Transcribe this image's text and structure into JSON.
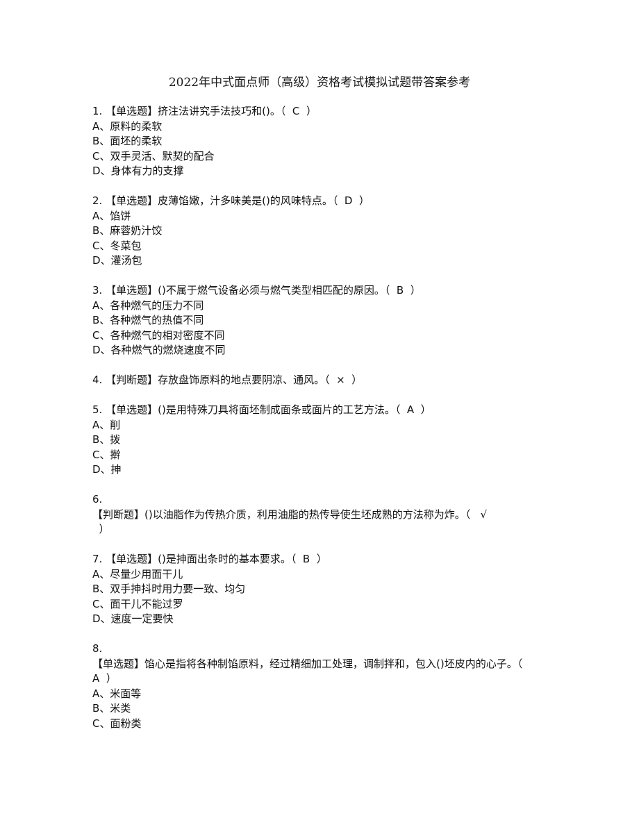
{
  "title": "2022年中式面点师（高级）资格考试模拟试题带答案参考",
  "questions": [
    {
      "number": "1.",
      "type": "【单选题】",
      "stem": "挤注法讲究手法技巧和()。",
      "answer": "C",
      "options": [
        "A、原料的柔软",
        "B、面坯的柔软",
        "C、双手灵活、默契的配合",
        "D、身体有力的支撑"
      ]
    },
    {
      "number": "2.",
      "type": "【单选题】",
      "stem": "皮薄馅嫩，汁多味美是()的风味特点。",
      "answer": "D",
      "options": [
        "A、馅饼",
        "B、麻蓉奶汁饺",
        "C、冬菜包",
        "D、灌汤包"
      ]
    },
    {
      "number": "3.",
      "type": "【单选题】",
      "stem": "()不属于燃气设备必须与燃气类型相匹配的原因。",
      "answer": "B",
      "options": [
        "A、各种燃气的压力不同",
        "B、各种燃气的热值不同",
        "C、各种燃气的相对密度不同",
        "D、各种燃气的燃烧速度不同"
      ]
    },
    {
      "number": "4.",
      "type": "【判断题】",
      "stem": "存放盘饰原料的地点要阴凉、通风。",
      "answer": "×",
      "options": []
    },
    {
      "number": "5.",
      "type": "【单选题】",
      "stem": "()是用特殊刀具将面坯制成面条或面片的工艺方法。",
      "answer": "A",
      "options": [
        "A、削",
        "B、拨",
        "C、擀",
        "D、抻"
      ]
    },
    {
      "number": "6.",
      "type": "【判断题】",
      "stem": "()以油脂作为传热介质，利用油脂的热传导使生坯成熟的方法称为炸。",
      "answer": "√",
      "options": []
    },
    {
      "number": "7.",
      "type": "【单选题】",
      "stem": "()是抻面出条时的基本要求。",
      "answer": "B",
      "options": [
        "A、尽量少用面干儿",
        "B、双手抻抖时用力要一致、均匀",
        "C、面干儿不能过罗",
        "D、速度一定要快"
      ]
    },
    {
      "number": "8.",
      "type": "【单选题】",
      "stem": "馅心是指将各种制馅原料，经过精细加工处理，调制拌和，包入()坯皮内的心子。",
      "answer": "A",
      "options": [
        "A、米面等",
        "B、米类",
        "C、面粉类"
      ]
    }
  ]
}
